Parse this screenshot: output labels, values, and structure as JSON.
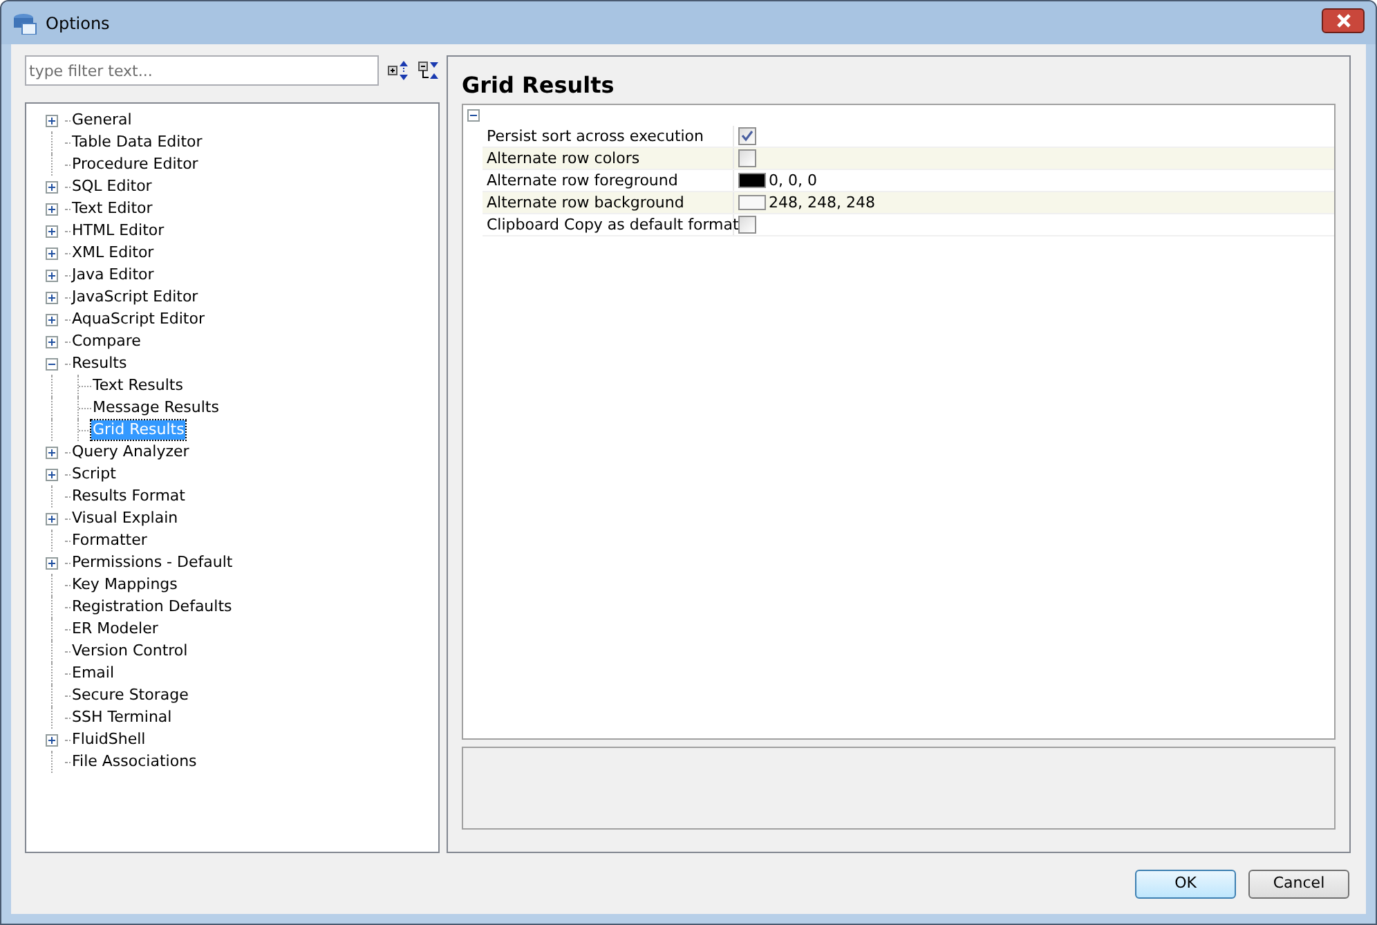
{
  "window": {
    "title": "Options"
  },
  "filter": {
    "placeholder": "type filter text..."
  },
  "tree": [
    {
      "label": "General",
      "expanded": false,
      "selected": false
    },
    {
      "label": "Table Data Editor",
      "selected": false
    },
    {
      "label": "Procedure Editor",
      "selected": false
    },
    {
      "label": "SQL Editor",
      "expanded": false,
      "selected": false
    },
    {
      "label": "Text Editor",
      "expanded": false,
      "selected": false
    },
    {
      "label": "HTML Editor",
      "expanded": false,
      "selected": false
    },
    {
      "label": "XML Editor",
      "expanded": false,
      "selected": false
    },
    {
      "label": "Java Editor",
      "expanded": false,
      "selected": false
    },
    {
      "label": "JavaScript Editor",
      "expanded": false,
      "selected": false
    },
    {
      "label": "AquaScript Editor",
      "expanded": false,
      "selected": false
    },
    {
      "label": "Compare",
      "expanded": false,
      "selected": false
    },
    {
      "label": "Results",
      "expanded": true,
      "selected": false,
      "children": [
        {
          "label": "Text Results",
          "selected": false
        },
        {
          "label": "Message Results",
          "selected": false
        },
        {
          "label": "Grid Results",
          "selected": true
        }
      ]
    },
    {
      "label": "Query Analyzer",
      "expanded": false,
      "selected": false
    },
    {
      "label": "Script",
      "expanded": false,
      "selected": false
    },
    {
      "label": "Results Format",
      "selected": false
    },
    {
      "label": "Visual Explain",
      "expanded": false,
      "selected": false
    },
    {
      "label": "Formatter",
      "selected": false
    },
    {
      "label": "Permissions - Default",
      "expanded": false,
      "selected": false
    },
    {
      "label": "Key Mappings",
      "selected": false
    },
    {
      "label": "Registration Defaults",
      "selected": false
    },
    {
      "label": "ER Modeler",
      "selected": false
    },
    {
      "label": "Version Control",
      "selected": false
    },
    {
      "label": "Email",
      "selected": false
    },
    {
      "label": "Secure Storage",
      "selected": false
    },
    {
      "label": "SSH Terminal",
      "selected": false
    },
    {
      "label": "FluidShell",
      "expanded": false,
      "selected": false
    },
    {
      "label": "File Associations",
      "selected": false
    }
  ],
  "page": {
    "title": "Grid Results",
    "group_expanded": true,
    "properties": [
      {
        "label": "Persist sort across execution",
        "kind": "checkbox",
        "checked": true
      },
      {
        "label": "Alternate row colors",
        "kind": "checkbox",
        "checked": false
      },
      {
        "label": "Alternate row foreground",
        "kind": "color",
        "color": "#000000",
        "value": "0, 0, 0"
      },
      {
        "label": "Alternate row background",
        "kind": "color",
        "color": "#f8f8f8",
        "value": "248, 248, 248"
      },
      {
        "label": "Clipboard Copy as default format",
        "kind": "checkbox",
        "checked": false
      }
    ]
  },
  "buttons": [
    "OK",
    "Cancel"
  ]
}
